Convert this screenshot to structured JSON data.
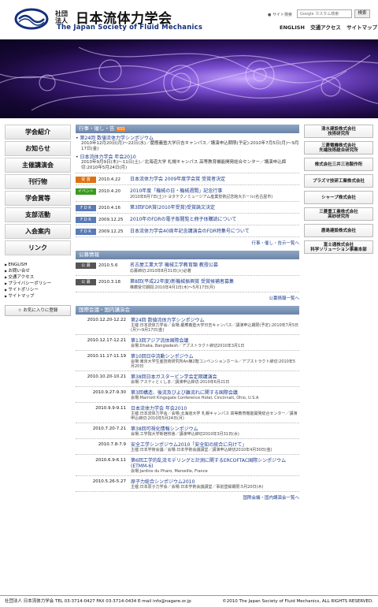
{
  "header": {
    "logo_small": "社団\n法人",
    "logo_title": "日本流体力学会",
    "logo_sub": "The Japan Society of Fluid Mechanics",
    "search_label": "サイト検索",
    "search_placeholder": "Google カスタム検索",
    "search_button": "検索",
    "top_links": [
      "ENGLISH",
      "交通アクセス",
      "サイトマップ"
    ]
  },
  "sidebar": {
    "nav": [
      "学会紹介",
      "お知らせ",
      "主催講演会",
      "刊行物",
      "学会賞等",
      "支部活動",
      "入会案内",
      "リンク"
    ],
    "sublinks": [
      "ENGLISH",
      "お問い合せ",
      "交通アクセス",
      "プライバシーポリシー",
      "サイトポリシー",
      "サイトマップ"
    ],
    "fav_label": "お気に入りに登録"
  },
  "events": {
    "head": "行事・催し・告",
    "news": [
      {
        "title": "第24回 数値流体力学シンポジウム",
        "sub": "2010年12月20日(月)〜22日(水)／慶應義塾大学日吉キャンパス／講演申込期限(予定):2010年7月5日(月)〜9月17日(金)"
      },
      {
        "title": "日本流体力学会 年会2010",
        "sub": "2010年9月9日(木)〜11日(土)／北海道大学 札幌キャンパス 高等教育機能開発総合センター／講演申込締切:2010年5月24日(月)"
      }
    ],
    "rows": [
      {
        "badge": "受 賞",
        "color": "#e07010",
        "date": "2010.4.22",
        "title": "日本流体力学会 2009年度学会賞 受賞者決定",
        "sub": ""
      },
      {
        "badge": "イベント",
        "color": "#3a9a20",
        "date": "2010.4.20",
        "title": "2010年度「機械の日・機械週間」記念行事",
        "sub": "2010年8月7日(土)トヨタテクノミュージアム産業技術記念館大ホール(名古屋市)"
      },
      {
        "badge": "F D R",
        "color": "#5a7ab8",
        "date": "2010.4.16",
        "title": "第3回FDR賞(2010年受賞)受賞論文決定",
        "sub": ""
      },
      {
        "badge": "F D R",
        "color": "#5a7ab8",
        "date": "2009.12.25",
        "title": "2010年のFDRの電子版閲覧と冊子体購読について",
        "sub": ""
      },
      {
        "badge": "F D R",
        "color": "#5a7ab8",
        "date": "2009.12.25",
        "title": "日本流体力学会40周年記念講演会のFDR特集号について",
        "sub": ""
      }
    ],
    "more": "行事・催し・告示一覧へ"
  },
  "recruit": {
    "head": "公募情報",
    "rows": [
      {
        "badge": "公 募",
        "color": "#555",
        "date": "2010.5.6",
        "title": "名古屋工業大学 機械工学教育類 教授公募",
        "sub": "応募締切:2010年8月31日(火)必着"
      },
      {
        "badge": "公 募",
        "color": "#555",
        "date": "2010.3.18",
        "title": "第8回(平成22年度)新機械振興賞 受賞候補者募集",
        "sub": "推薦受付期間:2010年4月1日(木)〜5月17日(月)"
      }
    ],
    "more": "公募情報一覧へ"
  },
  "conferences": {
    "head": "国際会議・国内講演会",
    "rows": [
      {
        "date": "2010.12.20-12.22",
        "title": "第24回 数値流体力学シンポジウム",
        "sub": "主催:日本流体力学会／会場:慶應義塾大学日吉キャンパス／講演申込期限(予定):2010年7月5日(月)〜9月17日(金)"
      },
      {
        "date": "2010.12.17-12.21",
        "title": "第13回アジア流体国際会議",
        "sub": "会場:Dhaka, Bangladesh／アブストラクト締切2010年3月1日"
      },
      {
        "date": "2010.11.17-11.19",
        "title": "第10回日中流動シンポジウム",
        "sub": "会場:東京大学生産技術研究所An棟2階コンベンションホール／アブストラクト締切:2010年5月20日"
      },
      {
        "date": "2010.10.20-10.21",
        "title": "第38回日本ガスタービン学会定期講演会",
        "sub": "会場:アスティとくしま／講演申込締切:2010年6月21日"
      },
      {
        "date": "2010.9.27-9.30",
        "title": "第3回構造、後流及びよび離流れに関する国際会議",
        "sub": "会場:Marriott Kingsgate Conference Hotel, Cincinnati, Ohio, U.S.A"
      },
      {
        "date": "2010.9.9-9.11",
        "title": "日本流体力学会 年会2010",
        "sub": "主催:日本流体力学会／会場:北海道大学 札幌キャンパス 高等教育機能開発総合センター／講演申込締切:2010年5月24日(月)"
      },
      {
        "date": "2010.7.20-7.21",
        "title": "第38回可視化情報シンポジウム",
        "sub": "会場:工学院大学新宿校舎／講演申込締切2010年3月31日(水)"
      },
      {
        "date": "2010.7.8-7.9",
        "title": "安全工学シンポジウム2010「安全知の統合に向けて」",
        "sub": "主催:日本学術会議／会場:日本学術会議講堂／講演申込締切2010年4月30日(金)"
      },
      {
        "date": "2010.6.9-6.11",
        "title": "第6回工学的乱流モデリングと計測に関するERCOFTAC国際シンポジウム(ETMM-6)",
        "sub": "会場:Jardins du Pharo, Marseille, France"
      },
      {
        "date": "2010.5.26-5.27",
        "title": "原子力総合シンポジウム2010",
        "sub": "主催:日本原子力学会／会場:日本学術会議講堂／事前登録期限:5月20日(木)"
      }
    ],
    "more": "国際会議・国内講演会一覧へ"
  },
  "ads": [
    "清水建設株式会社\n技術研究所",
    "三菱電機株式会社\n先端技術総合研究所",
    "株式会社三井三池製作所",
    "プラズマ技研工業株式会社",
    "シャープ株式会社",
    "三菱重工業株式会社\n高砂研究所",
    "鹿島建設株式会社",
    "富士通株式会社\n科学ソリューション事業本部"
  ],
  "footer": {
    "left": "社団法人 日本流体力学会  TEL 03-3714-0427  FAX 03-3714-0434  E-mail info@nagare.or.jp",
    "right": "©2010 The Japan Society of Fluid Mechanics, ALL RIGHTS RESERVED."
  }
}
